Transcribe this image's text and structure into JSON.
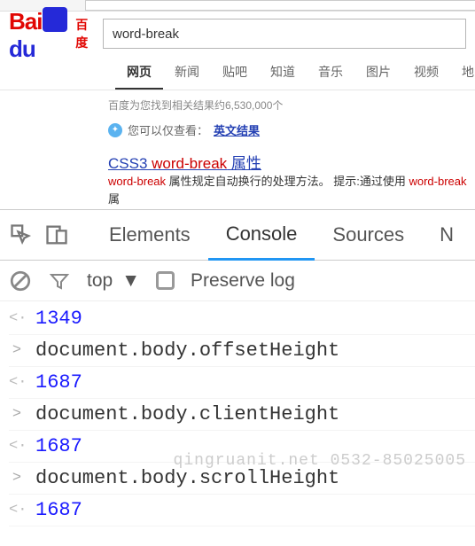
{
  "search": {
    "query": "word-break"
  },
  "tabs": [
    "网页",
    "新闻",
    "贴吧",
    "知道",
    "音乐",
    "图片",
    "视频",
    "地图"
  ],
  "result_count": "百度为您找到相关结果约6,530,000个",
  "suggest": {
    "prefix": "您可以仅查看：",
    "link": "英文结果"
  },
  "result": {
    "title_pre": "CSS3 ",
    "title_kw": "word-break",
    "title_post": " 属性",
    "snippet_kw1": "word-break",
    "snippet_mid": " 属性规定自动换行的处理方法。 提示:通过使用 ",
    "snippet_kw2": "word-break",
    "snippet_tail": " 属"
  },
  "devtools": {
    "tabs": [
      "Elements",
      "Console",
      "Sources",
      "N"
    ],
    "context": "top",
    "preserve": "Preserve log"
  },
  "console": [
    {
      "type": "out",
      "value": "1349"
    },
    {
      "type": "in",
      "expr": "document.body.offsetHeight"
    },
    {
      "type": "out",
      "value": "1687"
    },
    {
      "type": "in",
      "expr": "document.body.clientHeight"
    },
    {
      "type": "out",
      "value": "1687"
    },
    {
      "type": "in",
      "expr": "document.body.scrollHeight"
    },
    {
      "type": "out",
      "value": "1687"
    }
  ],
  "watermark": "qingruanit.net 0532-85025005"
}
